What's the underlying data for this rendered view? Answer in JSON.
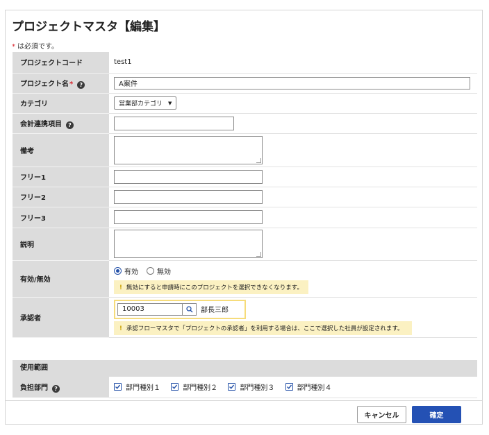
{
  "page": {
    "title": "プロジェクトマスタ【編集】"
  },
  "required_note": {
    "star": "*",
    "text": "は必須です。"
  },
  "fields": {
    "project_code": {
      "label": "プロジェクトコード",
      "value": "test1"
    },
    "project_name": {
      "label": "プロジェクト名",
      "star": "*",
      "value": "A案件"
    },
    "category": {
      "label": "カテゴリ",
      "selected": "営業部カテゴリ"
    },
    "accounting_item": {
      "label": "会計連携項目",
      "value": ""
    },
    "remarks": {
      "label": "備考",
      "value": ""
    },
    "free1": {
      "label": "フリー1",
      "value": ""
    },
    "free2": {
      "label": "フリー2",
      "value": ""
    },
    "free3": {
      "label": "フリー3",
      "value": ""
    },
    "description": {
      "label": "説明",
      "value": ""
    },
    "status": {
      "label": "有効/無効",
      "options": [
        "有効",
        "無効"
      ],
      "selected": "有効",
      "notice": "無効にすると申請時にこのプロジェクトを選択できなくなります。"
    },
    "approver": {
      "label": "承認者",
      "code": "10003",
      "name": "部長三郎",
      "notice": "承認フローマスタで「プロジェクトの承認者」を利用する場合は、ここで選択した社員が設定されます。"
    }
  },
  "usage_scope": {
    "section_label": "使用範囲",
    "dept_label": "負担部門",
    "departments": [
      {
        "label": "部門種別１",
        "checked": true
      },
      {
        "label": "部門種別２",
        "checked": true
      },
      {
        "label": "部門種別３",
        "checked": true
      },
      {
        "label": "部門種別４",
        "checked": true
      }
    ]
  },
  "buttons": {
    "cancel": "キャンセル",
    "confirm": "確定"
  },
  "icons": {
    "help": "question-icon",
    "search": "search-icon",
    "caret": "caret-down-icon",
    "check": "check-icon",
    "warning": "exclamation-icon"
  },
  "help_glyph": "?",
  "warning_glyph": "!",
  "colors": {
    "primary": "#2451b4",
    "required": "#d9232d",
    "notice_bg": "#fbf1c2",
    "label_bg": "#dcdcdc"
  }
}
